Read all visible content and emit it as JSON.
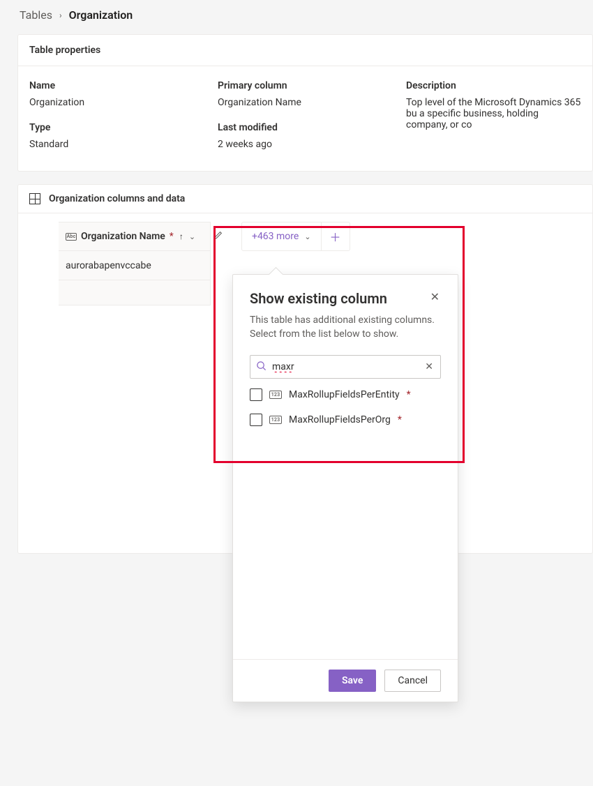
{
  "breadcrumb": {
    "root": "Tables",
    "current": "Organization"
  },
  "properties": {
    "title": "Table properties",
    "name_label": "Name",
    "name_value": "Organization",
    "type_label": "Type",
    "type_value": "Standard",
    "primary_label": "Primary column",
    "primary_value": "Organization Name",
    "modified_label": "Last modified",
    "modified_value": "2 weeks ago",
    "description_label": "Description",
    "description_value": "Top level of the Microsoft Dynamics 365 bu a specific business, holding company, or co"
  },
  "data_section": {
    "title": "Organization columns and data",
    "column_header": "Organization Name",
    "row_value": "aurorabapenvccabe",
    "more_label": "+463 more",
    "text_icon_label": "Abc"
  },
  "popup": {
    "title": "Show existing column",
    "description": "This table has additional existing columns. Select from the list below to show.",
    "search_value": "maxr",
    "num_icon_label": "123",
    "options": [
      {
        "label": "MaxRollupFieldsPerEntity",
        "required": true
      },
      {
        "label": "MaxRollupFieldsPerOrg",
        "required": true
      }
    ],
    "save_label": "Save",
    "cancel_label": "Cancel"
  }
}
